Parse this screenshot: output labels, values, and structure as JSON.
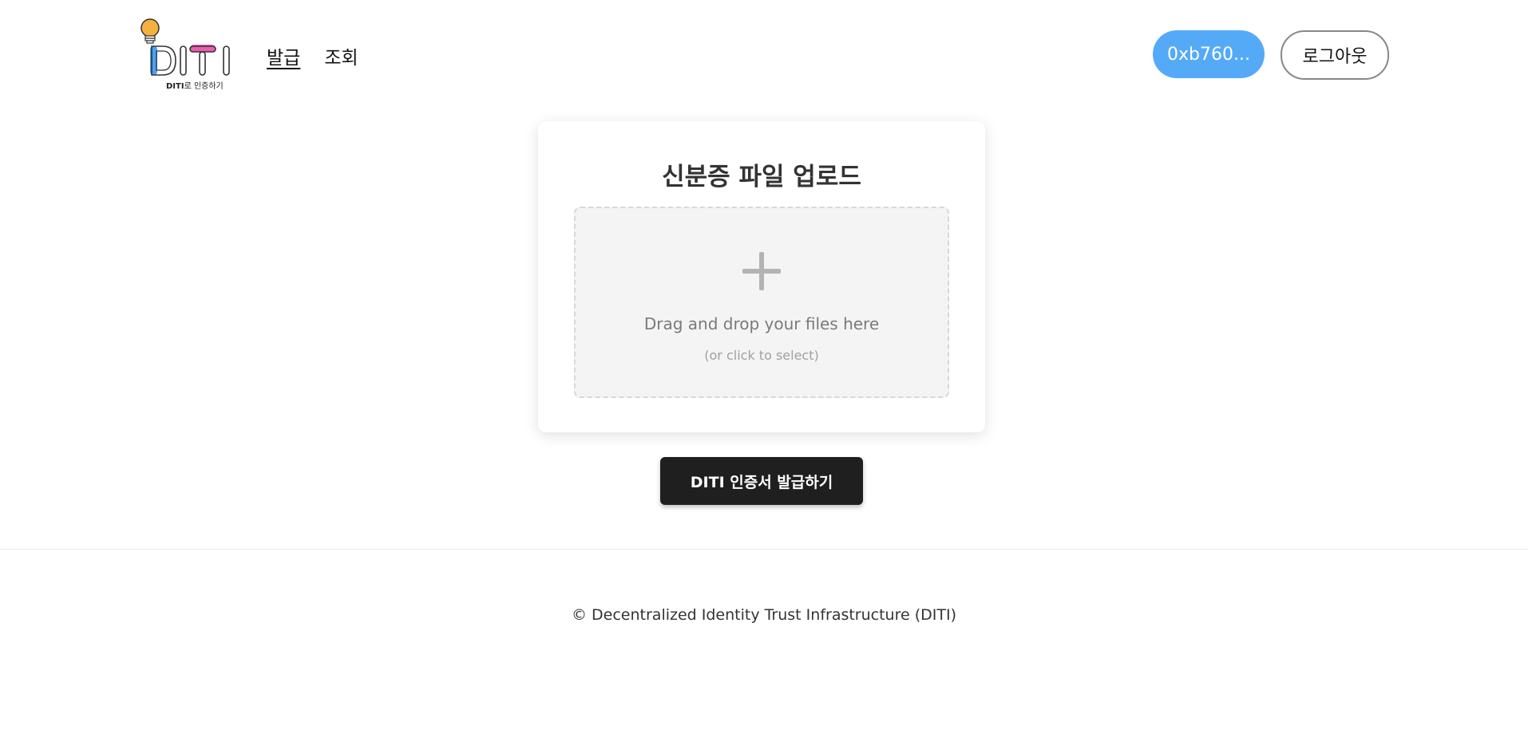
{
  "header": {
    "logo_text": "DITI",
    "logo_tagline_bold": "DITI",
    "logo_tagline_rest": "로 인증하기",
    "nav": [
      {
        "label": "발급",
        "active": true
      },
      {
        "label": "조회",
        "active": false
      }
    ],
    "wallet_label": "0xb760...",
    "logout_label": "로그아웃",
    "colors": {
      "wallet_bg": "#55aaf8",
      "logo_bulb": "#f5b041",
      "logo_blue": "#4aa3f0",
      "logo_pink": "#e85fb0"
    }
  },
  "upload": {
    "title": "신분증 파일 업로드",
    "dropzone_icon": "plus-icon",
    "dropzone_text": "Drag and drop your files here",
    "dropzone_subtext": "(or click to select)"
  },
  "actions": {
    "issue_label": "DITI 인증서 발급하기"
  },
  "footer": {
    "copyright": "© Decentralized Identity Trust Infrastructure (DITI)"
  }
}
